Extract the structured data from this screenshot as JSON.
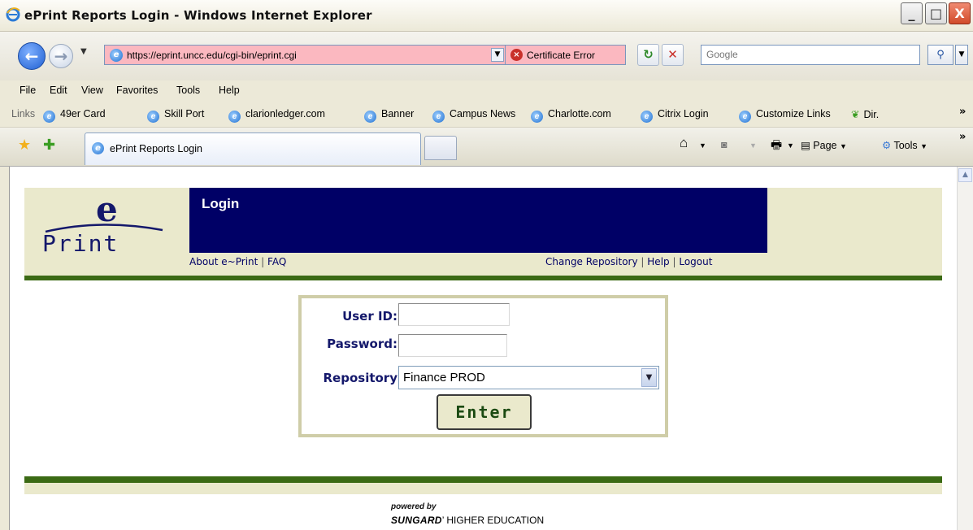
{
  "window": {
    "title": "ePrint Reports Login - Windows Internet Explorer",
    "minimize": "_",
    "maximize": "□",
    "close": "X"
  },
  "address": {
    "url": "https://eprint.uncc.edu/cgi-bin/eprint.cgi",
    "certificate_status": "Certificate Error",
    "search_placeholder": "Google"
  },
  "menu": [
    "File",
    "Edit",
    "View",
    "Favorites",
    "Tools",
    "Help"
  ],
  "links": {
    "label": "Links",
    "items": [
      "49er Card",
      "Skill Port",
      "clarionledger.com",
      "Banner",
      "Campus News",
      "Charlotte.com",
      "Citrix Login",
      "Customize Links",
      "Dir."
    ]
  },
  "tabs": {
    "active_title": "ePrint Reports Login"
  },
  "command_bar": {
    "page": "Page",
    "tools": "Tools"
  },
  "banner": {
    "logo_e": "e",
    "logo_print": "Print",
    "title": "Login",
    "left_links": [
      "About e~Print",
      "FAQ"
    ],
    "right_links": [
      "Change Repository",
      "Help",
      "Logout"
    ]
  },
  "login_form": {
    "userid_label": "User ID:",
    "userid_value": "",
    "password_label": "Password:",
    "password_value": "",
    "repository_label": "Repository",
    "repository_value": "Finance PROD",
    "enter_label": "Enter"
  },
  "footer": {
    "powered_by": "powered by",
    "brand": "SUNGARD",
    "brand_suffix": "’ HIGHER EDUCATION"
  },
  "colors": {
    "banner_bg": "#eae9cc",
    "header_navy": "#000066",
    "rule_green": "#3b6a14",
    "cert_error_bg": "#fbb8c0"
  }
}
